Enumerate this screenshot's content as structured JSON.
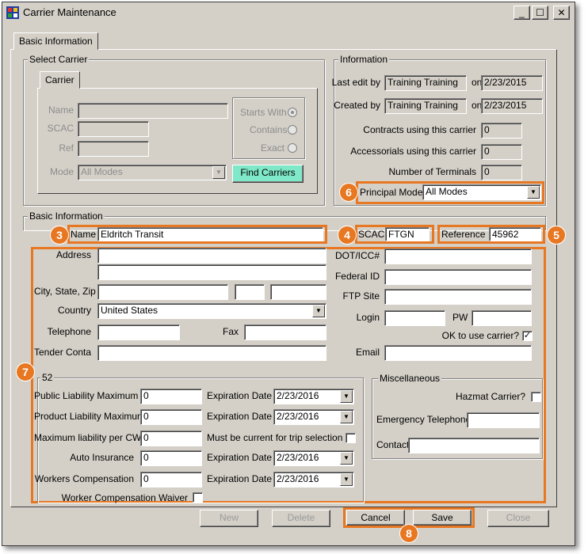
{
  "window": {
    "title": "Carrier Maintenance",
    "buttons": {
      "minimize": "_",
      "maximize": "☐",
      "close": "✕"
    }
  },
  "tabs": {
    "basic_information": "Basic Information",
    "carrier": "Carrier"
  },
  "select_carrier": {
    "title": "Select Carrier",
    "name_label": "Name",
    "scac_label": "SCAC",
    "ref_label": "Ref",
    "mode_label": "Mode",
    "mode_value": "All Modes",
    "starts_with": "Starts With",
    "contains": "Contains",
    "exact": "Exact",
    "find_button": "Find Carriers"
  },
  "information": {
    "title": "Information",
    "last_edit_label": "Last edit by",
    "last_edit_user": "Training Training",
    "on1": "on",
    "last_edit_date": "2/23/2015",
    "created_label": "Created by",
    "created_user": "Training Training",
    "on2": "on",
    "created_date": "2/23/2015",
    "contracts_label": "Contracts using this carrier",
    "contracts_value": "0",
    "accessorials_label": "Accessorials using this carrier",
    "accessorials_value": "0",
    "terminals_label": "Number of Terminals",
    "terminals_value": "0",
    "principal_mode_label": "Principal Mode",
    "principal_mode_value": "All Modes"
  },
  "basic": {
    "title": "Basic Information",
    "name_label": "Name",
    "name_value": "Eldritch Transit",
    "scac_label": "SCAC",
    "scac_value": "FTGN",
    "reference_label": "Reference",
    "reference_value": "45962",
    "address_label": "Address",
    "city_label": "City, State, Zip",
    "country_label": "Country",
    "country_value": "United States",
    "telephone_label": "Telephone",
    "fax_label": "Fax",
    "tender_label": "Tender Contact",
    "dot_label": "DOT/ICC#",
    "federal_label": "Federal ID",
    "ftp_label": "FTP Site",
    "login_label": "Login",
    "pw_label": "PW",
    "ok_label": "OK to use carrier?",
    "ok_check": "✓",
    "email_label": "Email"
  },
  "insurance": {
    "title": "52",
    "public_label": "Public Liability Maximum",
    "public_value": "0",
    "product_label": "Product Liability Maximum",
    "product_value": "0",
    "max_cwt_label": "Maximum liability per CWT",
    "max_cwt_value": "0",
    "auto_label": "Auto Insurance",
    "auto_value": "0",
    "workers_label": "Workers Compensation",
    "workers_value": "0",
    "waiver_label": "Worker Compensation Waiver",
    "exp_label": "Expiration Date",
    "exp1": "2/23/2016",
    "exp2": "2/23/2016",
    "exp3": "2/23/2016",
    "exp4": "2/23/2016",
    "must_current_label": "Must be current for trip selection"
  },
  "misc": {
    "title": "Miscellaneous",
    "hazmat_label": "Hazmat Carrier?",
    "emergency_label": "Emergency Telephone",
    "contact_label": "Contact"
  },
  "buttons": {
    "new": "New",
    "delete": "Delete",
    "cancel": "Cancel",
    "save": "Save",
    "close": "Close"
  },
  "callouts": {
    "c3": "3",
    "c4": "4",
    "c5": "5",
    "c6": "6",
    "c7": "7",
    "c8": "8"
  },
  "colors": {
    "callout": "#e87722",
    "find_button": "#7fe8c8",
    "window_bg": "#d4d0c8"
  }
}
